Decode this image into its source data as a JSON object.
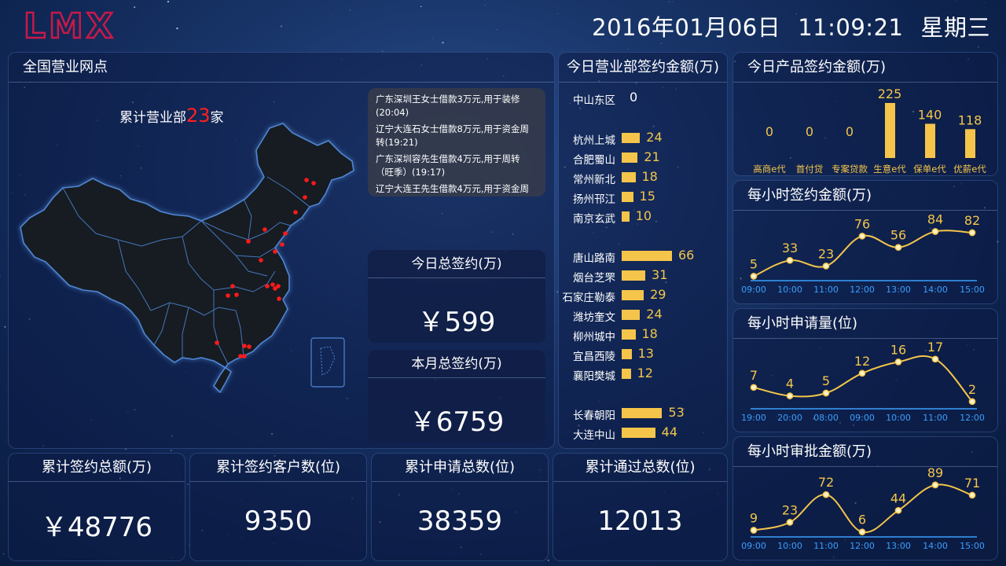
{
  "header": {
    "logo": "LMX",
    "date": "2016年01月06日",
    "time": "11:09:21",
    "weekday": "星期三"
  },
  "map_panel": {
    "title": "全国营业网点",
    "count_prefix": "累计营业部",
    "count": "23",
    "count_suffix": "家"
  },
  "feed": [
    "广东深圳王女士借款3万元,用于装修(20:04)",
    "辽宁大连石女士借款8万元,用于资金周转(19:21)",
    "广东深圳容先生借款4万元,用于周转（旺季）(19:17)",
    "辽宁大连王先生借款4万元,用于资金周"
  ],
  "today_total": {
    "title": "今日总签约(万)",
    "value": "￥599"
  },
  "month_total": {
    "title": "本月总签约(万)",
    "value": "￥6759"
  },
  "branch_panel": {
    "title": "今日营业部签约金额(万)",
    "rows": [
      {
        "name": "中山东区",
        "value": 0
      },
      {
        "name": "杭州上城",
        "value": 24
      },
      {
        "name": "合肥蜀山",
        "value": 21
      },
      {
        "name": "常州新北",
        "value": 18
      },
      {
        "name": "扬州邗江",
        "value": 15
      },
      {
        "name": "南京玄武",
        "value": 10
      },
      {
        "name": "唐山路南",
        "value": 66
      },
      {
        "name": "烟台芝罘",
        "value": 31
      },
      {
        "name": "石家庄勒泰",
        "value": 29
      },
      {
        "name": "潍坊奎文",
        "value": 24
      },
      {
        "name": "柳州城中",
        "value": 18
      },
      {
        "name": "宜昌西陵",
        "value": 13
      },
      {
        "name": "襄阳樊城",
        "value": 12
      },
      {
        "name": "长春朝阳",
        "value": 53
      },
      {
        "name": "大连中山",
        "value": 44
      }
    ]
  },
  "stats": [
    {
      "title": "累计签约总额(万)",
      "value": "￥48776"
    },
    {
      "title": "累计签约客户数(位)",
      "value": "9350"
    },
    {
      "title": "累计申请总数(位)",
      "value": "38359"
    },
    {
      "title": "累计通过总数(位)",
      "value": "12013"
    }
  ],
  "colors": {
    "accent": "#f4c54a",
    "marker": "#ff1a1a",
    "axis": "#3aa0ff",
    "logo": "#c8194a"
  },
  "chart_data": [
    {
      "type": "bar",
      "title": "今日产品签约金额(万)",
      "categories": [
        "高商e代",
        "首付贷",
        "专案贷款",
        "生意e代",
        "保单e代",
        "优薪e代"
      ],
      "values": [
        0,
        0,
        0,
        225,
        140,
        118
      ]
    },
    {
      "type": "line",
      "title": "每小时签约金额(万)",
      "x": [
        "09:00",
        "10:00",
        "11:00",
        "12:00",
        "13:00",
        "14:00",
        "15:00"
      ],
      "series": [
        {
          "values": [
            5,
            33,
            23,
            76,
            56,
            84,
            82
          ]
        }
      ],
      "ylim": [
        0,
        100
      ]
    },
    {
      "type": "line",
      "title": "每小时申请量(位)",
      "x": [
        "19:00",
        "20:00",
        "08:00",
        "09:00",
        "10:00",
        "11:00",
        "12:00"
      ],
      "series": [
        {
          "values": [
            7,
            4,
            5,
            12,
            16,
            17,
            2
          ]
        }
      ],
      "ylim": [
        0,
        20
      ]
    },
    {
      "type": "line",
      "title": "每小时审批金额(万)",
      "x": [
        "09:00",
        "10:00",
        "11:00",
        "12:00",
        "13:00",
        "14:00",
        "15:00"
      ],
      "series": [
        {
          "values": [
            9,
            23,
            72,
            6,
            44,
            89,
            71
          ]
        }
      ],
      "ylim": [
        0,
        100
      ]
    }
  ]
}
